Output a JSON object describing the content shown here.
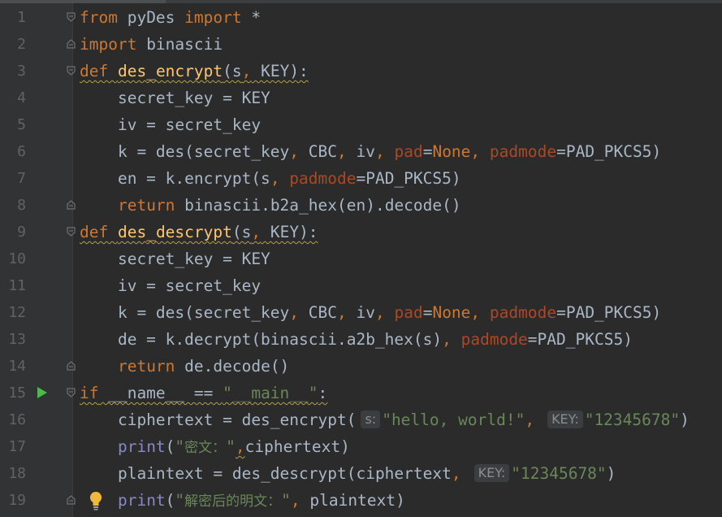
{
  "lines": [
    {
      "n": "1",
      "t": {
        "a": "from",
        "b": " pyDes ",
        "c": "import",
        "d": " *"
      }
    },
    {
      "n": "2",
      "t": {
        "a": "import",
        "b": " binascii"
      }
    },
    {
      "n": "3",
      "t": {
        "a": "def",
        "b": " ",
        "c": "des_encrypt",
        "d": "(s",
        "e": ",",
        "f": " KEY):"
      }
    },
    {
      "n": "4",
      "t": {
        "a": "    secret_key = KEY"
      }
    },
    {
      "n": "5",
      "t": {
        "a": "    iv = secret_key"
      }
    },
    {
      "n": "6",
      "t": {
        "a": "    k = des(secret_key",
        "b": ",",
        "c": " CBC",
        "d": ",",
        "e": " iv",
        "f": ",",
        "g": " pad",
        "h": "=",
        "i": "None",
        "j": ",",
        "k": " padmode",
        "l": "=PAD_PKCS5)"
      }
    },
    {
      "n": "7",
      "t": {
        "a": "    en = k.encrypt(s",
        "b": ",",
        "c": " padmode",
        "d": "=PAD_PKCS5)"
      }
    },
    {
      "n": "8",
      "t": {
        "a": "    ",
        "b": "return",
        "c": " binascii.b2a_hex(en).decode()"
      }
    },
    {
      "n": "9",
      "t": {
        "a": "def",
        "b": " ",
        "c": "des_descrypt",
        "d": "(s",
        "e": ",",
        "f": " KEY):"
      }
    },
    {
      "n": "10",
      "t": {
        "a": "    secret_key = KEY"
      }
    },
    {
      "n": "11",
      "t": {
        "a": "    iv = secret_key"
      }
    },
    {
      "n": "12",
      "t": {
        "a": "    k = des(secret_key",
        "b": ",",
        "c": " CBC",
        "d": ",",
        "e": " iv",
        "f": ",",
        "g": " pad",
        "h": "=",
        "i": "None",
        "j": ",",
        "k": " padmode",
        "l": "=PAD_PKCS5)"
      }
    },
    {
      "n": "13",
      "t": {
        "a": "    de = k.decrypt(binascii.a2b_hex(s)",
        "b": ",",
        "c": " padmode",
        "d": "=PAD_PKCS5)"
      }
    },
    {
      "n": "14",
      "t": {
        "a": "    ",
        "b": "return",
        "c": " de.decode()"
      }
    },
    {
      "n": "15",
      "t": {
        "a": "if",
        "b": " __name__ == ",
        "c": "\"__main__\"",
        "d": ":"
      }
    },
    {
      "n": "16",
      "t": {
        "a": "    ciphertext = des_encrypt(",
        "h1": "s:",
        "b": "\"hello, world!\"",
        "c": ",",
        "h2": "KEY:",
        "d": "\"12345678\"",
        "e": ")"
      }
    },
    {
      "n": "17",
      "t": {
        "a": "    ",
        "b": "print",
        "c": "(",
        "d": "\"",
        "cj": "密文：",
        "e": "\"",
        "f": ",",
        "g": "ciphertext)"
      }
    },
    {
      "n": "18",
      "t": {
        "a": "    plaintext = des_descrypt(ciphertext",
        "b": ",",
        "h1": "KEY:",
        "c": "\"12345678\"",
        "d": ")"
      }
    },
    {
      "n": "19",
      "t": {
        "a": "    ",
        "b": "print",
        "c": "(",
        "d": "\"",
        "cj": "解密后的明文：",
        "e": "\"",
        "f": ",",
        "g": " plaintext)"
      }
    }
  ],
  "icons": {
    "run": "run-gutter-icon",
    "bulb": "intention-bulb-icon",
    "fold": "fold-marker-icon"
  },
  "colors": {
    "background": "#2b2b2b",
    "keyword": "#cc7832",
    "function": "#ffc66d",
    "string": "#6a8759",
    "parameter": "#aa4926",
    "builtin": "#8888c6",
    "text": "#a9b7c6"
  }
}
